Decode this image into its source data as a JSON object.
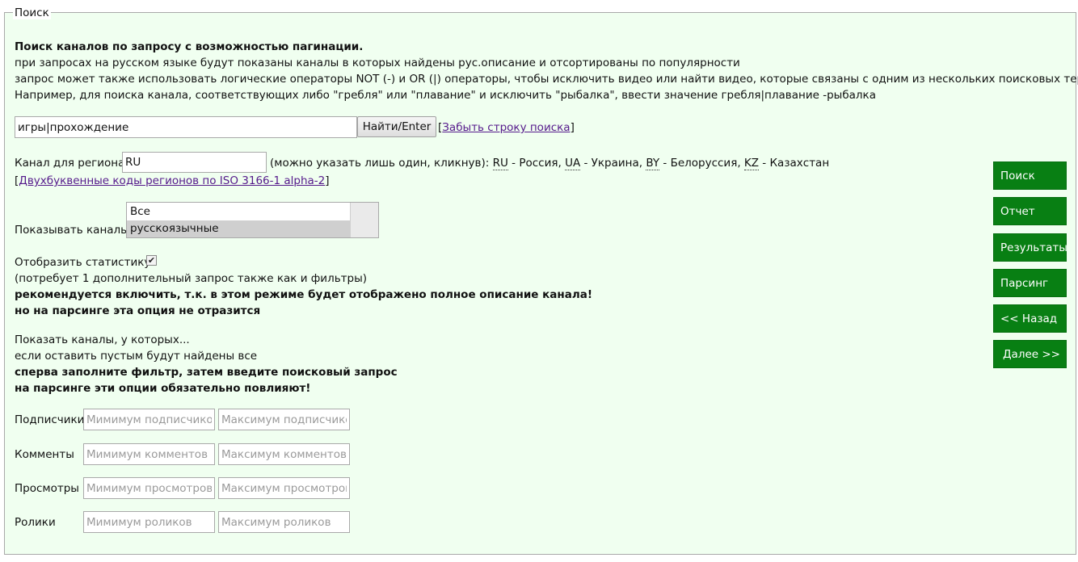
{
  "fieldset": {
    "legend": "Поиск"
  },
  "intro": {
    "heading": "Поиск каналов по запросу с возможностью пагинации.",
    "line1": "при запросах на русском языке будут показаны каналы в которых найдены рус.описание и отсортированы по популярности",
    "line2": "запрос может также использовать логические операторы NOT (-) и OR (|) операторы, чтобы исключить видео или найти видео, которые связаны с одним из нескольких поисковых терминов.",
    "line3": "Например, для поиска канала, соответствующих либо \"гребля\" или \"плавание\" и исключить \"рыбалка\", ввести значение гребля|плавание -рыбалка"
  },
  "search": {
    "value": "игры|прохождение",
    "button": "Найти/Enter",
    "forget_open": "[",
    "forget_link": "Забыть строку поиска",
    "forget_close": "]"
  },
  "region": {
    "label": "Канал для региона",
    "value": "RU",
    "hint": "(можно указать лишь один, кликнув):",
    "codes": [
      {
        "code": "RU",
        "name": " - Россия, "
      },
      {
        "code": "UA",
        "name": " - Украина, "
      },
      {
        "code": "BY",
        "name": " - Белоруссия, "
      },
      {
        "code": "KZ",
        "name": " - Казахстан"
      }
    ],
    "iso_open": "[",
    "iso_link": "Двухбуквенные коды регионов по ISO 3166-1 alpha-2",
    "iso_close": "]"
  },
  "show_channels": {
    "label": "Показывать каналы",
    "options": [
      "Все",
      "русскоязычные"
    ],
    "selected": "русскоязычные"
  },
  "stats": {
    "label": "Отобразить статистику",
    "checked": true,
    "note": "(потребует 1 дополнительный запрос также как и фильтры)",
    "bold1": "рекомендуется включить, т.к. в этом режиме будет отображено полное описание канала!",
    "bold2": "но на парсинге эта опция не отразится"
  },
  "filters_intro": {
    "line1": "Показать каналы, у которых...",
    "line2": "если оставить пустым будут найдены все",
    "bold1": "сперва заполните фильтр, затем введите поисковый запрос",
    "bold2": "на парсинге эти опции обязательно повлияют!"
  },
  "filters": [
    {
      "label": "Подписчики",
      "min_placeholder": "Мимимум подписчиков",
      "max_placeholder": "Максимум подписчиков"
    },
    {
      "label": "Комменты",
      "min_placeholder": "Мимимум комментов",
      "max_placeholder": "Максимум комментов"
    },
    {
      "label": "Просмотры",
      "min_placeholder": "Мимимум просмотров",
      "max_placeholder": "Максимум просмотров"
    },
    {
      "label": "Ролики",
      "min_placeholder": "Мимимум роликов",
      "max_placeholder": "Максимум роликов"
    }
  ],
  "side_buttons": [
    "Поиск",
    "Отчет",
    "Результаты",
    "Парсинг",
    "<< Назад",
    "Далее >>"
  ],
  "colors": {
    "panel_bg": "#f0fff0",
    "button_green": "#087f13",
    "link": "#551a8b"
  }
}
